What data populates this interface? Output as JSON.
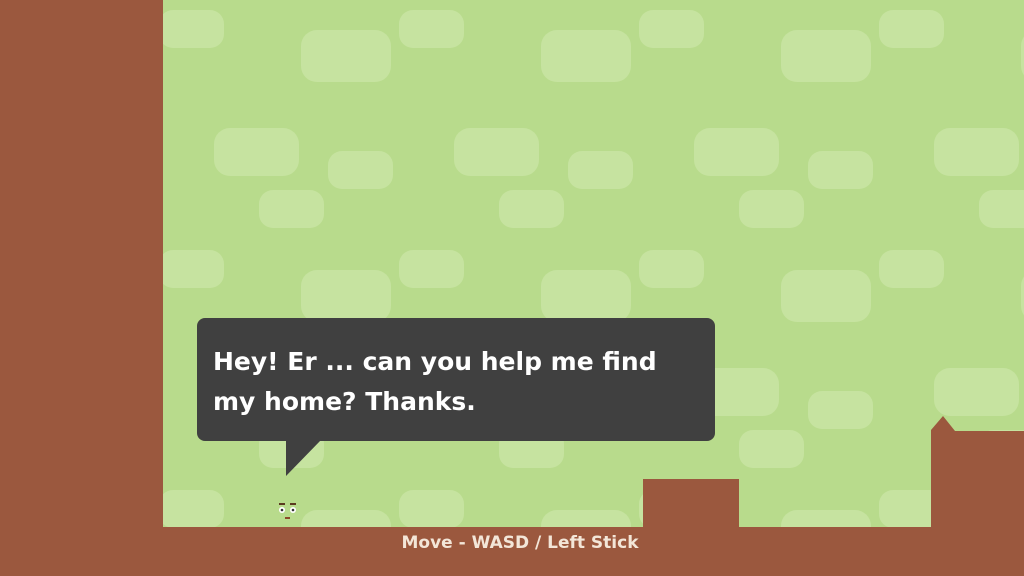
{
  "dialog": {
    "text": "Hey! Er ... can you help me find my home? Thanks."
  },
  "controls_hint": "Move - WASD / Left Stick",
  "colors": {
    "background": "#b8db8c",
    "cloud": "#c6e3a0",
    "ground": "#9b583e",
    "bubble": "#404040"
  }
}
